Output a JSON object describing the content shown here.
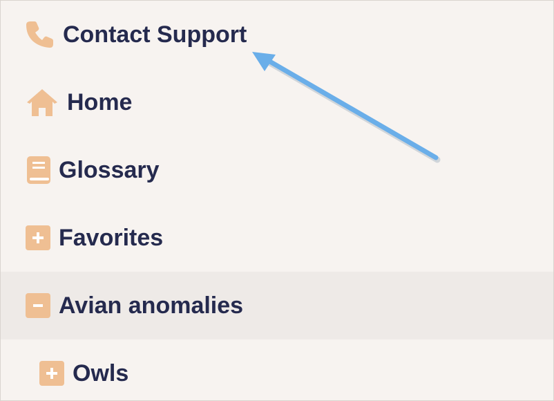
{
  "menu": {
    "items": [
      {
        "label": "Contact Support",
        "icon": "phone-icon"
      },
      {
        "label": "Home",
        "icon": "home-icon"
      },
      {
        "label": "Glossary",
        "icon": "book-icon"
      },
      {
        "label": "Favorites",
        "icon": "plus-square-icon"
      },
      {
        "label": "Avian anomalies",
        "icon": "minus-square-icon",
        "selected": true
      },
      {
        "label": "Owls",
        "icon": "plus-square-icon"
      }
    ]
  },
  "colors": {
    "icon": "#efbf93",
    "text": "#252a4e",
    "background": "#f7f3f0",
    "selected_background": "#eeeae7",
    "annotation_arrow": "#6aaee9"
  }
}
